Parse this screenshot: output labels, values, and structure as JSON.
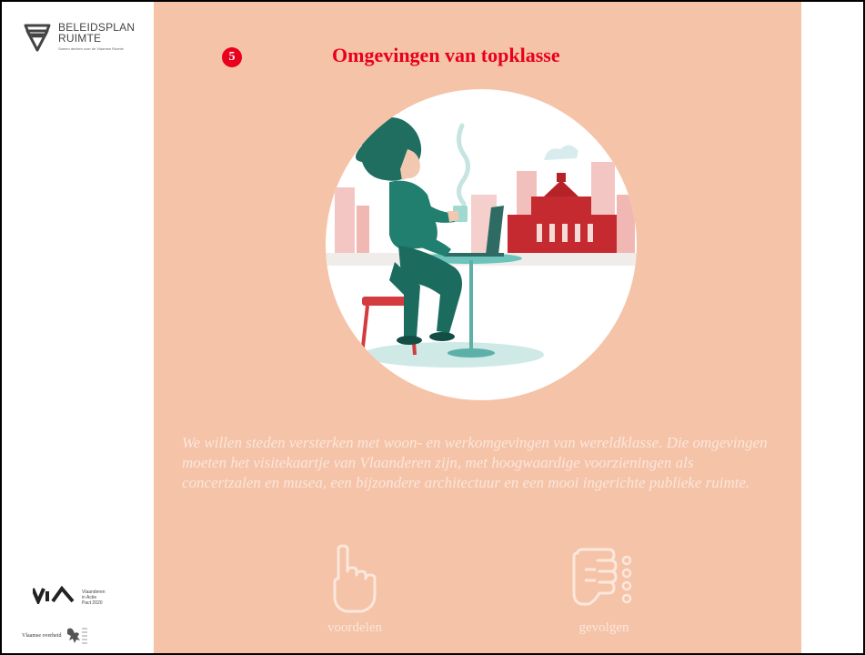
{
  "brand": {
    "line1": "BELEIDSPLAN",
    "line2": "RUIMTE",
    "tagline": "Samen denken over de Vlaamse Ruimte",
    "logo_icon": "beleidsplan-shield-icon"
  },
  "via": {
    "mark": "VIA",
    "lines": [
      "Vlaanderen",
      "in Actie",
      "Pact 2020"
    ]
  },
  "government": {
    "text": "Vlaamse overheid",
    "logo_icon": "flemish-lion-icon"
  },
  "slide": {
    "step_number": "5",
    "title": "Omgevingen van topklasse",
    "description": "We willen steden versterken met woon- en werkomgevingen van wereldklasse. Die omgevingen moeten het visitekaartje van Vlaanderen zijn, met hoogwaardige voorzieningen als concertzalen en musea, een bijzondere architectuur en een mooi ingerichte publieke ruimte.",
    "illustration_icon": "woman-at-cafe-table-city-icon"
  },
  "actions": [
    {
      "label": "voordelen",
      "icon": "pointing-hand-icon"
    },
    {
      "label": "gevolgen",
      "icon": "hand-list-icon"
    }
  ],
  "colors": {
    "panel_bg": "#f5c3a8",
    "accent_red": "#e8001c",
    "light_text": "#fbe7dc"
  }
}
